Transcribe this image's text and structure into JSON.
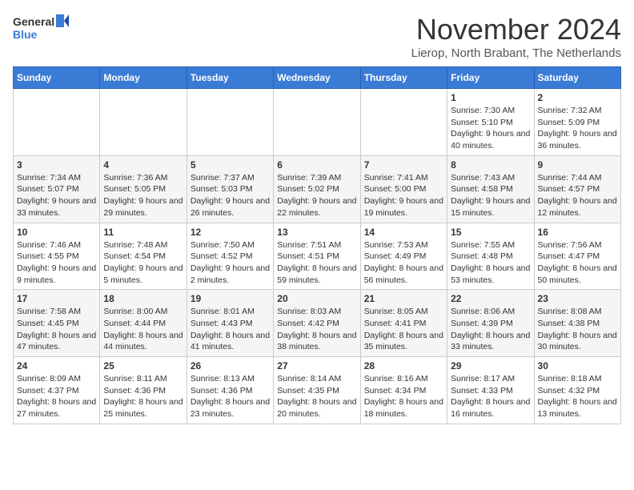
{
  "logo": {
    "line1": "General",
    "line2": "Blue"
  },
  "header": {
    "month": "November 2024",
    "location": "Lierop, North Brabant, The Netherlands"
  },
  "weekdays": [
    "Sunday",
    "Monday",
    "Tuesday",
    "Wednesday",
    "Thursday",
    "Friday",
    "Saturday"
  ],
  "weeks": [
    [
      {
        "day": "",
        "info": ""
      },
      {
        "day": "",
        "info": ""
      },
      {
        "day": "",
        "info": ""
      },
      {
        "day": "",
        "info": ""
      },
      {
        "day": "",
        "info": ""
      },
      {
        "day": "1",
        "info": "Sunrise: 7:30 AM\nSunset: 5:10 PM\nDaylight: 9 hours and 40 minutes."
      },
      {
        "day": "2",
        "info": "Sunrise: 7:32 AM\nSunset: 5:09 PM\nDaylight: 9 hours and 36 minutes."
      }
    ],
    [
      {
        "day": "3",
        "info": "Sunrise: 7:34 AM\nSunset: 5:07 PM\nDaylight: 9 hours and 33 minutes."
      },
      {
        "day": "4",
        "info": "Sunrise: 7:36 AM\nSunset: 5:05 PM\nDaylight: 9 hours and 29 minutes."
      },
      {
        "day": "5",
        "info": "Sunrise: 7:37 AM\nSunset: 5:03 PM\nDaylight: 9 hours and 26 minutes."
      },
      {
        "day": "6",
        "info": "Sunrise: 7:39 AM\nSunset: 5:02 PM\nDaylight: 9 hours and 22 minutes."
      },
      {
        "day": "7",
        "info": "Sunrise: 7:41 AM\nSunset: 5:00 PM\nDaylight: 9 hours and 19 minutes."
      },
      {
        "day": "8",
        "info": "Sunrise: 7:43 AM\nSunset: 4:58 PM\nDaylight: 9 hours and 15 minutes."
      },
      {
        "day": "9",
        "info": "Sunrise: 7:44 AM\nSunset: 4:57 PM\nDaylight: 9 hours and 12 minutes."
      }
    ],
    [
      {
        "day": "10",
        "info": "Sunrise: 7:46 AM\nSunset: 4:55 PM\nDaylight: 9 hours and 9 minutes."
      },
      {
        "day": "11",
        "info": "Sunrise: 7:48 AM\nSunset: 4:54 PM\nDaylight: 9 hours and 5 minutes."
      },
      {
        "day": "12",
        "info": "Sunrise: 7:50 AM\nSunset: 4:52 PM\nDaylight: 9 hours and 2 minutes."
      },
      {
        "day": "13",
        "info": "Sunrise: 7:51 AM\nSunset: 4:51 PM\nDaylight: 8 hours and 59 minutes."
      },
      {
        "day": "14",
        "info": "Sunrise: 7:53 AM\nSunset: 4:49 PM\nDaylight: 8 hours and 56 minutes."
      },
      {
        "day": "15",
        "info": "Sunrise: 7:55 AM\nSunset: 4:48 PM\nDaylight: 8 hours and 53 minutes."
      },
      {
        "day": "16",
        "info": "Sunrise: 7:56 AM\nSunset: 4:47 PM\nDaylight: 8 hours and 50 minutes."
      }
    ],
    [
      {
        "day": "17",
        "info": "Sunrise: 7:58 AM\nSunset: 4:45 PM\nDaylight: 8 hours and 47 minutes."
      },
      {
        "day": "18",
        "info": "Sunrise: 8:00 AM\nSunset: 4:44 PM\nDaylight: 8 hours and 44 minutes."
      },
      {
        "day": "19",
        "info": "Sunrise: 8:01 AM\nSunset: 4:43 PM\nDaylight: 8 hours and 41 minutes."
      },
      {
        "day": "20",
        "info": "Sunrise: 8:03 AM\nSunset: 4:42 PM\nDaylight: 8 hours and 38 minutes."
      },
      {
        "day": "21",
        "info": "Sunrise: 8:05 AM\nSunset: 4:41 PM\nDaylight: 8 hours and 35 minutes."
      },
      {
        "day": "22",
        "info": "Sunrise: 8:06 AM\nSunset: 4:39 PM\nDaylight: 8 hours and 33 minutes."
      },
      {
        "day": "23",
        "info": "Sunrise: 8:08 AM\nSunset: 4:38 PM\nDaylight: 8 hours and 30 minutes."
      }
    ],
    [
      {
        "day": "24",
        "info": "Sunrise: 8:09 AM\nSunset: 4:37 PM\nDaylight: 8 hours and 27 minutes."
      },
      {
        "day": "25",
        "info": "Sunrise: 8:11 AM\nSunset: 4:36 PM\nDaylight: 8 hours and 25 minutes."
      },
      {
        "day": "26",
        "info": "Sunrise: 8:13 AM\nSunset: 4:36 PM\nDaylight: 8 hours and 23 minutes."
      },
      {
        "day": "27",
        "info": "Sunrise: 8:14 AM\nSunset: 4:35 PM\nDaylight: 8 hours and 20 minutes."
      },
      {
        "day": "28",
        "info": "Sunrise: 8:16 AM\nSunset: 4:34 PM\nDaylight: 8 hours and 18 minutes."
      },
      {
        "day": "29",
        "info": "Sunrise: 8:17 AM\nSunset: 4:33 PM\nDaylight: 8 hours and 16 minutes."
      },
      {
        "day": "30",
        "info": "Sunrise: 8:18 AM\nSunset: 4:32 PM\nDaylight: 8 hours and 13 minutes."
      }
    ]
  ]
}
